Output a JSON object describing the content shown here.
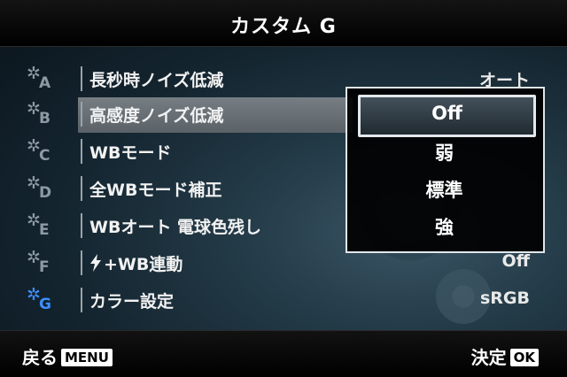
{
  "header": {
    "title": "カスタム G"
  },
  "rows": [
    {
      "icon_letter": "A",
      "label": "長秒時ノイズ低減",
      "value": "オート"
    },
    {
      "icon_letter": "B",
      "label": "高感度ノイズ低減",
      "value": ""
    },
    {
      "icon_letter": "C",
      "label": "WBモード",
      "value": ""
    },
    {
      "icon_letter": "D",
      "label": "全WBモード補正",
      "value": ""
    },
    {
      "icon_letter": "E",
      "label": "WBオート 電球色残し",
      "value": ""
    },
    {
      "icon_letter": "F",
      "label": "+WB連動",
      "value": "Off"
    },
    {
      "icon_letter": "G",
      "label": "カラー設定",
      "value": "sRGB"
    }
  ],
  "popup": {
    "options": [
      "Off",
      "弱",
      "標準",
      "強"
    ],
    "selected": "Off"
  },
  "footer": {
    "back_label": "戻る",
    "back_button": "MENU",
    "ok_label": "決定",
    "ok_button": "OK"
  },
  "colors": {
    "active_icon": "#3d8fff",
    "highlight": "#6b737a"
  },
  "icons": {
    "row_icon": "gear-icon",
    "flash": "flash-icon"
  }
}
